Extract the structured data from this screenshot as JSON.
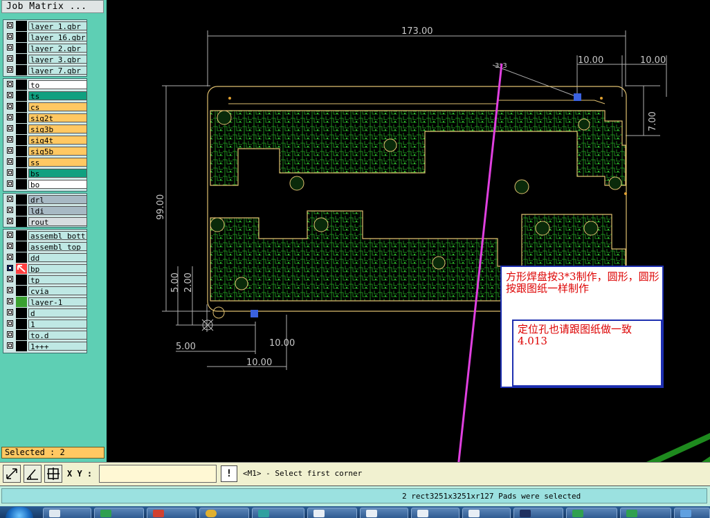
{
  "panel": {
    "title": "Job Matrix ...",
    "selected_text": "Selected : 2",
    "layers": [
      {
        "name": "layer_1.gbr",
        "color": "#bfe8e4"
      },
      {
        "name": "layer_16.gbr",
        "color": "#bfe8e4"
      },
      {
        "name": "layer_2.gbr",
        "color": "#bfe8e4"
      },
      {
        "name": "layer_3.gbr",
        "color": "#bfe8e4"
      },
      {
        "name": "layer_7.gbr",
        "color": "#bfe8e4"
      },
      {
        "name": "to",
        "color": "#ffffff"
      },
      {
        "name": "ts",
        "color": "#10a080"
      },
      {
        "name": "cs",
        "color": "#ffc862"
      },
      {
        "name": "sig2t",
        "color": "#ffc862"
      },
      {
        "name": "sig3b",
        "color": "#ffc862"
      },
      {
        "name": "sig4t",
        "color": "#ffc862"
      },
      {
        "name": "sig5b",
        "color": "#ffc862"
      },
      {
        "name": "ss",
        "color": "#ffc862"
      },
      {
        "name": "bs",
        "color": "#10a080"
      },
      {
        "name": "bo",
        "color": "#ffffff"
      },
      {
        "name": "drl",
        "color": "#a7b9c4"
      },
      {
        "name": "ldi",
        "color": "#a7b9c4"
      },
      {
        "name": "rout",
        "color": "#d7dde0"
      },
      {
        "name": "assembl_bott",
        "color": "#bfe8e4"
      },
      {
        "name": "assembl_top",
        "color": "#bfe8e4"
      },
      {
        "name": "dd",
        "color": "#bfe8e4"
      },
      {
        "name": "bp",
        "color": "#bfe8e4"
      },
      {
        "name": "tp",
        "color": "#bfe8e4"
      },
      {
        "name": "cvia",
        "color": "#bfe8e4"
      },
      {
        "name": "layer-1",
        "color": "#bfe8e4"
      },
      {
        "name": "d",
        "color": "#bfe8e4"
      },
      {
        "name": "1",
        "color": "#bfe8e4"
      },
      {
        "name": "to.d",
        "color": "#bfe8e4"
      },
      {
        "name": "1+++",
        "color": "#bfe8e4"
      }
    ]
  },
  "canvas": {
    "dimensions": {
      "top_width": "173.00",
      "right_1": "10.00",
      "right_2": "10.00",
      "right_vertical": "7.00",
      "left_height": "99.00",
      "left_5": "5.00",
      "left_2": "2.00",
      "bottom_5": "5.00",
      "bottom_10_a": "10.00",
      "bottom_10_b": "10.00",
      "pad_label": "3*3"
    },
    "note_1": "方形焊盘按3*3制作，圆形，圆形按跟图纸一样制作",
    "note_2": "定位孔也请跟图纸做一致4.013"
  },
  "toolbar": {
    "xy_label": "X Y :",
    "xy_value": "",
    "alert_label": "!",
    "prompt": "<M1> - Select first corner"
  },
  "status": {
    "message": "2 rect3251x3251xr127 Pads were selected"
  },
  "colors": {
    "board_outline": "#e0c070",
    "trace": "#1e8a1e",
    "dimension": "#b0b0b0",
    "arrow": "#e040e0",
    "selected_pad": "#3a62e0"
  }
}
